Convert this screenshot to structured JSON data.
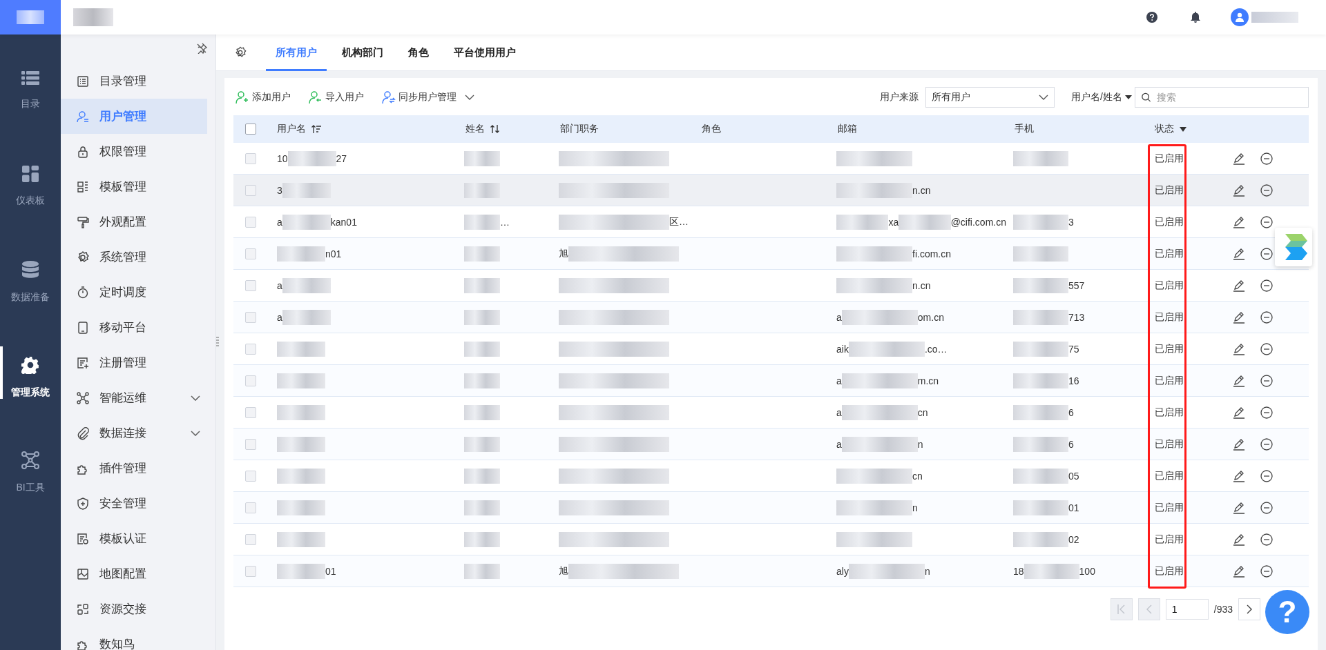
{
  "header": {
    "logo_redacted": true,
    "title_redacted": true,
    "user_redacted": true
  },
  "rail": [
    {
      "label": "目录",
      "selected": false
    },
    {
      "label": "仪表板",
      "selected": false
    },
    {
      "label": "数据准备",
      "selected": false
    },
    {
      "label": "管理系统",
      "selected": true
    },
    {
      "label": "BI工具",
      "selected": false
    }
  ],
  "sidebar": {
    "items": [
      {
        "label": "目录管理",
        "kind": "link",
        "selected": false
      },
      {
        "label": "用户管理",
        "kind": "link",
        "selected": true
      },
      {
        "label": "权限管理",
        "kind": "link",
        "selected": false
      },
      {
        "label": "模板管理",
        "kind": "link",
        "selected": false
      },
      {
        "label": "外观配置",
        "kind": "link",
        "selected": false
      },
      {
        "label": "系统管理",
        "kind": "link",
        "selected": false
      },
      {
        "label": "定时调度",
        "kind": "link",
        "selected": false
      },
      {
        "label": "移动平台",
        "kind": "link",
        "selected": false
      },
      {
        "label": "注册管理",
        "kind": "link",
        "selected": false
      },
      {
        "label": "智能运维",
        "kind": "group",
        "selected": false
      },
      {
        "label": "数据连接",
        "kind": "group",
        "selected": false
      },
      {
        "label": "插件管理",
        "kind": "link",
        "selected": false
      },
      {
        "label": "安全管理",
        "kind": "link",
        "selected": false
      },
      {
        "label": "模板认证",
        "kind": "link",
        "selected": false
      },
      {
        "label": "地图配置",
        "kind": "link",
        "selected": false
      },
      {
        "label": "资源交接",
        "kind": "link",
        "selected": false
      },
      {
        "label": "数知鸟",
        "kind": "link",
        "selected": false
      }
    ]
  },
  "tabs": [
    {
      "label": "所有用户",
      "selected": true
    },
    {
      "label": "机构部门",
      "selected": false
    },
    {
      "label": "角色",
      "selected": false
    },
    {
      "label": "平台使用用户",
      "selected": false
    }
  ],
  "toolbar": {
    "actions": [
      {
        "label": "添加用户",
        "kind": "add"
      },
      {
        "label": "导入用户",
        "kind": "import"
      },
      {
        "label": "同步用户管理",
        "kind": "sync"
      }
    ],
    "source_label": "用户来源",
    "source_value": "所有用户",
    "search_scope": "用户名/姓名",
    "search_placeholder": "搜索"
  },
  "table": {
    "status_frame": true,
    "all_checked": false,
    "columns": [
      {
        "label": "用户名",
        "kind": "sort"
      },
      {
        "label": "姓名",
        "kind": "updown"
      },
      {
        "label": "部门职务",
        "kind": "plain"
      },
      {
        "label": "角色",
        "kind": "plain"
      },
      {
        "label": "邮箱",
        "kind": "plain"
      },
      {
        "label": "手机",
        "kind": "plain"
      },
      {
        "label": "状态",
        "kind": "filter"
      }
    ],
    "rows": [
      {
        "checked": false,
        "highlighted": false,
        "username": [
          {
            "kind": "text",
            "text": "10"
          },
          {
            "kind": "blur"
          },
          {
            "kind": "text",
            "text": "27"
          }
        ],
        "name": [
          {
            "kind": "blur"
          }
        ],
        "department": [
          {
            "kind": "blur"
          }
        ],
        "email": [
          {
            "kind": "blur"
          }
        ],
        "phone": [
          {
            "kind": "blur"
          }
        ],
        "status": "已启用"
      },
      {
        "checked": false,
        "highlighted": true,
        "username": [
          {
            "kind": "text",
            "text": "3"
          },
          {
            "kind": "blur"
          }
        ],
        "name": [
          {
            "kind": "blur"
          }
        ],
        "department": [
          {
            "kind": "blur"
          }
        ],
        "email": [
          {
            "kind": "blur"
          },
          {
            "kind": "text",
            "text": "n.cn"
          }
        ],
        "phone": [],
        "status": "已启用"
      },
      {
        "checked": false,
        "highlighted": false,
        "username": [
          {
            "kind": "text",
            "text": "a"
          },
          {
            "kind": "blur"
          },
          {
            "kind": "text",
            "text": "kan01"
          }
        ],
        "name": [
          {
            "kind": "blur"
          },
          {
            "kind": "text",
            "text": "…"
          }
        ],
        "department": [
          {
            "kind": "blur"
          },
          {
            "kind": "text",
            "text": "区…"
          }
        ],
        "email": [
          {
            "kind": "blur"
          },
          {
            "kind": "text",
            "text": "xa"
          },
          {
            "kind": "blur"
          },
          {
            "kind": "text",
            "text": "@cifi.com.cn"
          }
        ],
        "phone": [
          {
            "kind": "blur"
          },
          {
            "kind": "text",
            "text": "3"
          }
        ],
        "status": "已启用"
      },
      {
        "checked": false,
        "highlighted": false,
        "username": [
          {
            "kind": "blur"
          },
          {
            "kind": "text",
            "text": "n01"
          }
        ],
        "name": [
          {
            "kind": "blur"
          }
        ],
        "department": [
          {
            "kind": "text",
            "text": "旭"
          },
          {
            "kind": "blur"
          }
        ],
        "email": [
          {
            "kind": "blur"
          },
          {
            "kind": "text",
            "text": "fi.com.cn"
          }
        ],
        "phone": [
          {
            "kind": "blur"
          }
        ],
        "status": "已启用"
      },
      {
        "checked": false,
        "highlighted": false,
        "username": [
          {
            "kind": "text",
            "text": "a"
          },
          {
            "kind": "blur"
          }
        ],
        "name": [
          {
            "kind": "blur"
          }
        ],
        "department": [
          {
            "kind": "blur"
          }
        ],
        "email": [
          {
            "kind": "blur"
          },
          {
            "kind": "text",
            "text": "n.cn"
          }
        ],
        "phone": [
          {
            "kind": "blur"
          },
          {
            "kind": "text",
            "text": "557"
          }
        ],
        "status": "已启用"
      },
      {
        "checked": false,
        "highlighted": false,
        "username": [
          {
            "kind": "text",
            "text": "a"
          },
          {
            "kind": "blur"
          }
        ],
        "name": [
          {
            "kind": "blur"
          }
        ],
        "department": [
          {
            "kind": "blur"
          }
        ],
        "email": [
          {
            "kind": "text",
            "text": "a"
          },
          {
            "kind": "blur"
          },
          {
            "kind": "text",
            "text": "om.cn"
          }
        ],
        "phone": [
          {
            "kind": "blur"
          },
          {
            "kind": "text",
            "text": "713"
          }
        ],
        "status": "已启用"
      },
      {
        "checked": false,
        "highlighted": false,
        "username": [
          {
            "kind": "blur"
          }
        ],
        "name": [
          {
            "kind": "blur"
          }
        ],
        "department": [
          {
            "kind": "blur"
          }
        ],
        "email": [
          {
            "kind": "text",
            "text": "aik"
          },
          {
            "kind": "blur"
          },
          {
            "kind": "text",
            "text": ".co…"
          }
        ],
        "phone": [
          {
            "kind": "blur"
          },
          {
            "kind": "text",
            "text": "75"
          }
        ],
        "status": "已启用"
      },
      {
        "checked": false,
        "highlighted": false,
        "username": [
          {
            "kind": "blur"
          }
        ],
        "name": [
          {
            "kind": "blur"
          }
        ],
        "department": [
          {
            "kind": "blur"
          }
        ],
        "email": [
          {
            "kind": "text",
            "text": "a"
          },
          {
            "kind": "blur"
          },
          {
            "kind": "text",
            "text": "m.cn"
          }
        ],
        "phone": [
          {
            "kind": "blur"
          },
          {
            "kind": "text",
            "text": "16"
          }
        ],
        "status": "已启用"
      },
      {
        "checked": false,
        "highlighted": false,
        "username": [
          {
            "kind": "blur"
          }
        ],
        "name": [
          {
            "kind": "blur"
          }
        ],
        "department": [
          {
            "kind": "blur"
          }
        ],
        "email": [
          {
            "kind": "text",
            "text": "a"
          },
          {
            "kind": "blur"
          },
          {
            "kind": "text",
            "text": "cn"
          }
        ],
        "phone": [
          {
            "kind": "blur"
          },
          {
            "kind": "text",
            "text": "6"
          }
        ],
        "status": "已启用"
      },
      {
        "checked": false,
        "highlighted": false,
        "username": [
          {
            "kind": "blur"
          }
        ],
        "name": [
          {
            "kind": "blur"
          }
        ],
        "department": [
          {
            "kind": "blur"
          }
        ],
        "email": [
          {
            "kind": "text",
            "text": "a"
          },
          {
            "kind": "blur"
          },
          {
            "kind": "text",
            "text": "n"
          }
        ],
        "phone": [
          {
            "kind": "blur"
          },
          {
            "kind": "text",
            "text": "6"
          }
        ],
        "status": "已启用"
      },
      {
        "checked": false,
        "highlighted": false,
        "username": [
          {
            "kind": "blur"
          }
        ],
        "name": [
          {
            "kind": "blur"
          }
        ],
        "department": [
          {
            "kind": "blur"
          }
        ],
        "email": [
          {
            "kind": "blur"
          },
          {
            "kind": "text",
            "text": "cn"
          }
        ],
        "phone": [
          {
            "kind": "blur"
          },
          {
            "kind": "text",
            "text": "05"
          }
        ],
        "status": "已启用"
      },
      {
        "checked": false,
        "highlighted": false,
        "username": [
          {
            "kind": "blur"
          }
        ],
        "name": [
          {
            "kind": "blur"
          }
        ],
        "department": [
          {
            "kind": "blur"
          }
        ],
        "email": [
          {
            "kind": "blur"
          },
          {
            "kind": "text",
            "text": "n"
          }
        ],
        "phone": [
          {
            "kind": "blur"
          },
          {
            "kind": "text",
            "text": "01"
          }
        ],
        "status": "已启用"
      },
      {
        "checked": false,
        "highlighted": false,
        "username": [
          {
            "kind": "blur"
          }
        ],
        "name": [
          {
            "kind": "blur"
          }
        ],
        "department": [
          {
            "kind": "blur"
          }
        ],
        "email": [
          {
            "kind": "blur"
          }
        ],
        "phone": [
          {
            "kind": "blur"
          },
          {
            "kind": "text",
            "text": "02"
          }
        ],
        "status": "已启用"
      },
      {
        "checked": false,
        "highlighted": false,
        "username": [
          {
            "kind": "blur"
          },
          {
            "kind": "text",
            "text": "01"
          }
        ],
        "name": [
          {
            "kind": "blur"
          }
        ],
        "department": [
          {
            "kind": "text",
            "text": "旭"
          },
          {
            "kind": "blur"
          }
        ],
        "email": [
          {
            "kind": "text",
            "text": "aly"
          },
          {
            "kind": "blur"
          },
          {
            "kind": "text",
            "text": "n"
          }
        ],
        "phone": [
          {
            "kind": "text",
            "text": "18"
          },
          {
            "kind": "blur"
          },
          {
            "kind": "text",
            "text": "100"
          }
        ],
        "status": "已启用"
      }
    ]
  },
  "pager": {
    "page": "1",
    "total": "/933",
    "first_disabled": true,
    "prev_disabled": true
  },
  "help_button": {
    "label": "?"
  }
}
